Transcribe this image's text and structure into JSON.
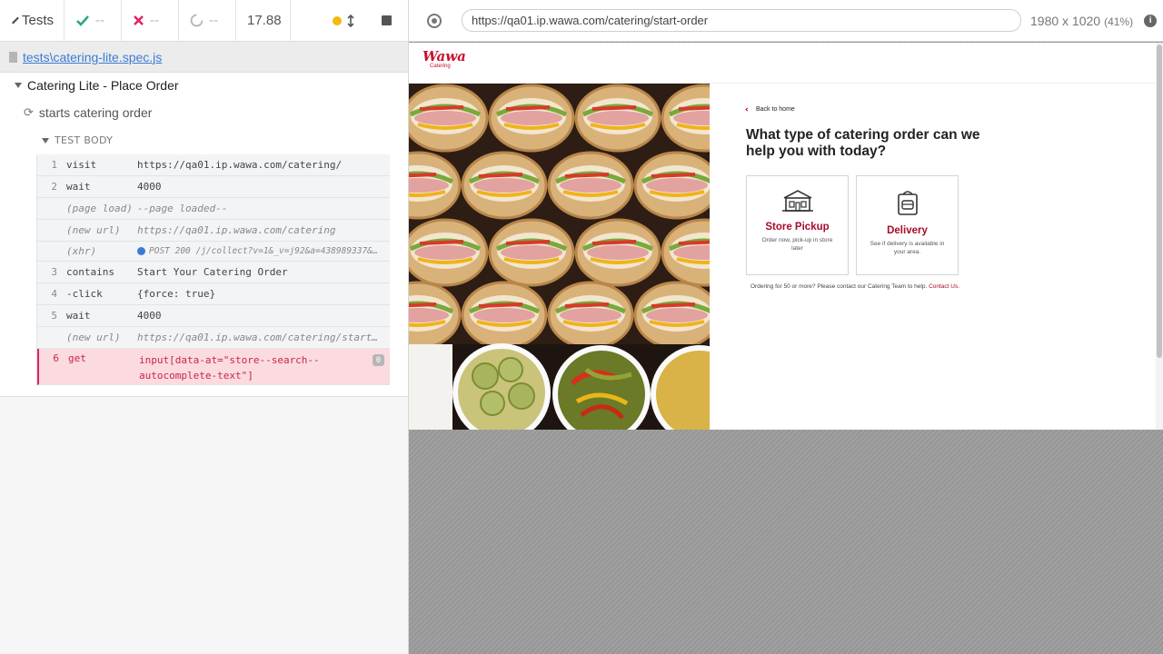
{
  "reporter": {
    "tests_label": "Tests",
    "passed": "--",
    "failed": "--",
    "pending": "--",
    "duration": "17.88",
    "spec_file": "tests\\catering-lite.spec.js",
    "suite_title": "Catering Lite - Place Order",
    "test_title": "starts catering order",
    "body_label": "TEST BODY",
    "commands": [
      {
        "num": "1",
        "name": "visit",
        "msg": "https://qa01.ip.wawa.com/catering/"
      },
      {
        "num": "2",
        "name": "wait",
        "msg": "4000"
      },
      {
        "num": "",
        "name": "(page load)",
        "msg": "--page loaded--"
      },
      {
        "num": "",
        "name": "(new url)",
        "msg": "https://qa01.ip.wawa.com/catering"
      },
      {
        "num": "",
        "name": "(xhr)",
        "msg": "POST 200 /j/collect?v=1&_v=j92&a=438989337&t=..."
      },
      {
        "num": "3",
        "name": "contains",
        "msg": "Start Your Catering Order"
      },
      {
        "num": "4",
        "name": "-click",
        "msg": "{force: true}"
      },
      {
        "num": "5",
        "name": "wait",
        "msg": "4000"
      },
      {
        "num": "",
        "name": "(new url)",
        "msg": "https://qa01.ip.wawa.com/catering/start-..."
      },
      {
        "num": "6",
        "name": "get",
        "msg": "input[data-at=\"store--search--autocomplete-text\"]",
        "badge": "0"
      }
    ]
  },
  "aut": {
    "url": "https://qa01.ip.wawa.com/catering/start-order",
    "viewport": "1980 x 1020",
    "zoom": "(41%)"
  },
  "page": {
    "logo_text": "Wawa",
    "logo_sub": "Catering",
    "back_link": "Back to home",
    "question": "What type of catering order can we help you with today?",
    "cards": [
      {
        "title": "Store Pickup",
        "subtitle": "Order now, pick-up in store later",
        "icon": "store-icon"
      },
      {
        "title": "Delivery",
        "subtitle": "See if delivery is available in your area.",
        "icon": "delivery-bag-icon"
      }
    ],
    "note": "Ordering for 50 or more? Please contact our Catering Team to help.",
    "note_link": "Contact Us."
  },
  "colors": {
    "brand_red": "#c8102e",
    "error_bg": "#fbdbdf",
    "link_blue": "#3b7bd4"
  }
}
